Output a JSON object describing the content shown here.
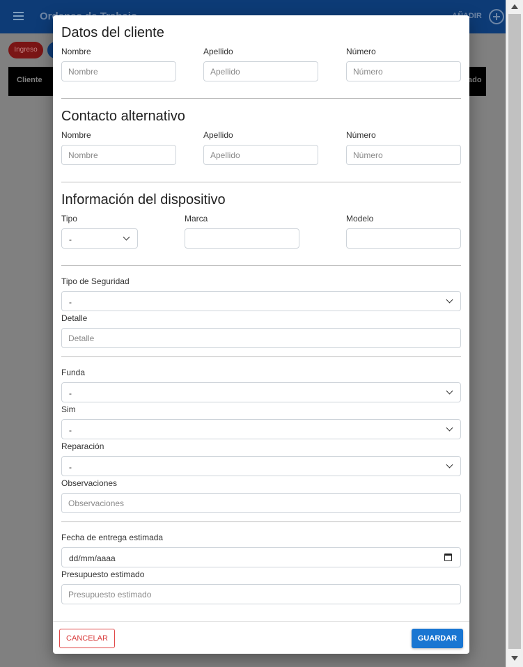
{
  "app": {
    "title": "Ordenes de Trabajo",
    "add_label": "AÑADIR",
    "chip_ingreso": "Ingreso",
    "table_col_first": "Cliente",
    "table_col_last": "ado"
  },
  "dialog": {
    "cliente": {
      "title": "Datos del cliente",
      "nombre_label": "Nombre",
      "nombre_placeholder": "Nombre",
      "apellido_label": "Apellido",
      "apellido_placeholder": "Apellido",
      "numero_label": "Número",
      "numero_placeholder": "Número"
    },
    "contacto": {
      "title": "Contacto alternativo",
      "nombre_label": "Nombre",
      "nombre_placeholder": "Nombre",
      "apellido_label": "Apellido",
      "apellido_placeholder": "Apellido",
      "numero_label": "Número",
      "numero_placeholder": "Número"
    },
    "dispositivo": {
      "title": "Información del dispositivo",
      "tipo_label": "Tipo",
      "tipo_value": "-",
      "marca_label": "Marca",
      "modelo_label": "Modelo"
    },
    "seguridad": {
      "tipo_label": "Tipo de Seguridad",
      "tipo_value": "-",
      "detalle_label": "Detalle",
      "detalle_placeholder": "Detalle"
    },
    "extras": {
      "funda_label": "Funda",
      "funda_value": "-",
      "sim_label": "Sim",
      "sim_value": "-",
      "reparacion_label": "Reparación",
      "reparacion_value": "-",
      "observaciones_label": "Observaciones",
      "observaciones_placeholder": "Observaciones"
    },
    "entrega": {
      "fecha_label": "Fecha de entrega estimada",
      "fecha_value": "dd/mm/aaaa",
      "presupuesto_label": "Presupuesto estimado",
      "presupuesto_placeholder": "Presupuesto estimado"
    },
    "footer": {
      "cancel_label": "CANCELAR",
      "save_label": "GUARDAR"
    }
  },
  "colors": {
    "primary": "#1976d2",
    "danger": "#d83a3a",
    "appbar": "#0d3b76"
  }
}
